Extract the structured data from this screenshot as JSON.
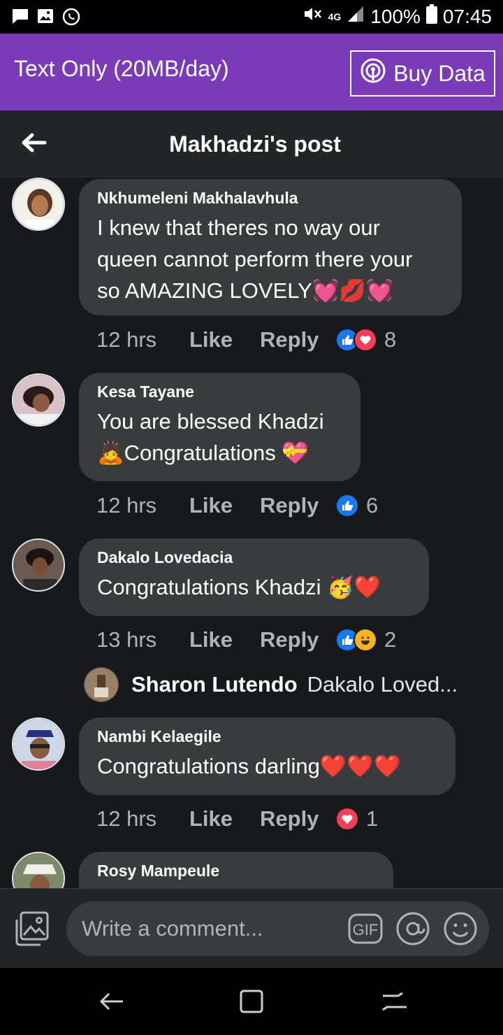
{
  "status": {
    "battery": "100%",
    "time": "07:45",
    "network": "4G"
  },
  "banner": {
    "title": "Text Only (20MB/day)",
    "buy_label": "Buy Data"
  },
  "header": {
    "title": "Makhadzi's post"
  },
  "comments": [
    {
      "name": "Nkhumeleni Makhalavhula",
      "text_lines": [
        "I knew that theres no way our",
        "queen cannot perform there your",
        "so AMAZING LOVELY💓💋💓"
      ],
      "time": "12 hrs",
      "like": "Like",
      "reply": "Reply",
      "reaction_count": "8"
    },
    {
      "name": "Kesa Tayane",
      "text_lines": [
        "You are blessed Khadzi",
        "🙇Congratulations 💝"
      ],
      "time": "12 hrs",
      "like": "Like",
      "reply": "Reply",
      "reaction_count": "6"
    },
    {
      "name": "Dakalo Lovedacia",
      "text_lines": [
        "Congratulations Khadzi 🥳❤️"
      ],
      "time": "13 hrs",
      "like": "Like",
      "reply": "Reply",
      "reaction_count": "2"
    },
    {
      "name": "Nambi Kelaegile",
      "text_lines": [
        "Congratulations darling❤️❤️❤️"
      ],
      "time": "12 hrs",
      "like": "Like",
      "reply": "Reply",
      "reaction_count": "1"
    },
    {
      "name": "Rosy Mampeule"
    }
  ],
  "reply_preview": {
    "name": "Sharon Lutendo",
    "text": "Dakalo Loved..."
  },
  "composer": {
    "placeholder": "Write a comment..."
  },
  "colors": {
    "banner": "#7a3bb8",
    "like_blue": "#1877f2",
    "love_red": "#f33e58",
    "bubble": "#3a3b3c",
    "background": "#18191a"
  }
}
